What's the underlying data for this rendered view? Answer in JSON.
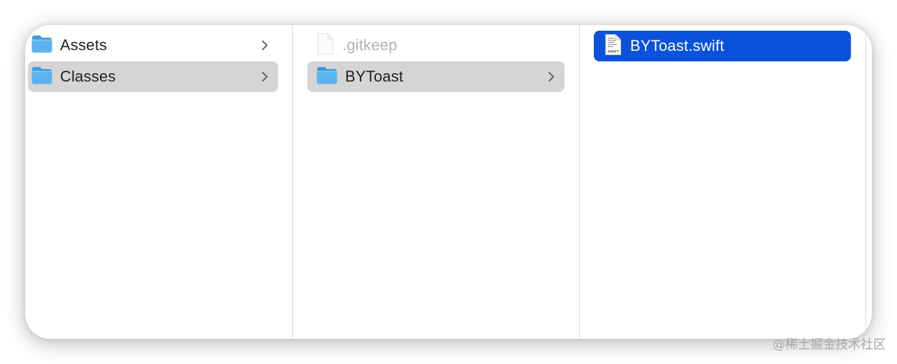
{
  "columns": [
    {
      "items": [
        {
          "label": "Assets",
          "icon": "folder-icon",
          "has_children": true,
          "state": "normal"
        },
        {
          "label": "Classes",
          "icon": "folder-icon",
          "has_children": true,
          "state": "selected-inactive"
        }
      ]
    },
    {
      "items": [
        {
          "label": ".gitkeep",
          "icon": "blank-file-icon",
          "has_children": false,
          "state": "hidden-file"
        },
        {
          "label": "BYToast",
          "icon": "folder-icon",
          "has_children": true,
          "state": "selected-inactive"
        }
      ]
    },
    {
      "items": [
        {
          "label": "BYToast.swift",
          "icon": "swift-file-icon",
          "has_children": false,
          "state": "selected-active",
          "icon_text": "SWIFT"
        }
      ]
    }
  ],
  "watermark": "@稀土掘金技术社区",
  "colors": {
    "selection_active": "#0a52db",
    "selection_inactive": "#d5d5d5",
    "folder_blue": "#5ab3f0",
    "hidden_text": "#b3b3b3"
  }
}
